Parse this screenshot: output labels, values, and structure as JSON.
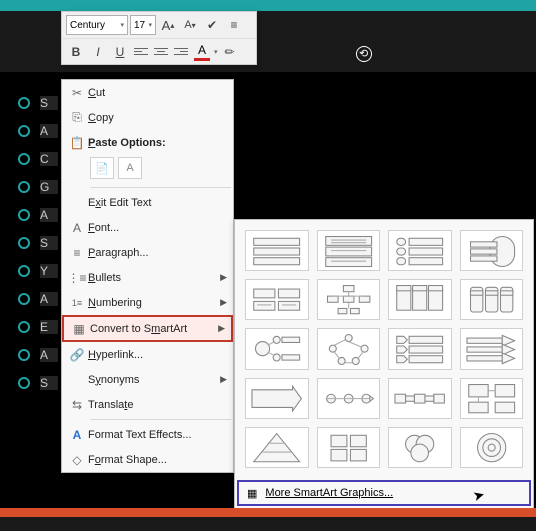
{
  "toolbar": {
    "font_name": "Century",
    "font_size": "17",
    "increase_font": "A",
    "decrease_font": "A",
    "bold": "B",
    "italic": "I",
    "underline": "U",
    "font_color_letter": "A"
  },
  "context_menu": {
    "cut": "Cut",
    "copy": "Copy",
    "paste_options": "Paste Options:",
    "exit_edit": "Exit Edit Text",
    "font": "Font...",
    "paragraph": "Paragraph...",
    "bullets": "Bullets",
    "numbering": "Numbering",
    "convert_smartart": "Convert to SmartArt",
    "hyperlink": "Hyperlink...",
    "synonyms": "Synonyms",
    "translate": "Translate",
    "format_text_effects": "Format Text Effects...",
    "format_shape": "Format Shape..."
  },
  "smartart": {
    "more": "More SmartArt Graphics..."
  },
  "bullets": [
    {
      "text": "S"
    },
    {
      "text": "A"
    },
    {
      "text": "C"
    },
    {
      "text": "G"
    },
    {
      "text": "A"
    },
    {
      "text": "S"
    },
    {
      "text": "Y"
    },
    {
      "text": "A"
    },
    {
      "text": "E"
    },
    {
      "text": "A"
    },
    {
      "text": "S"
    }
  ]
}
